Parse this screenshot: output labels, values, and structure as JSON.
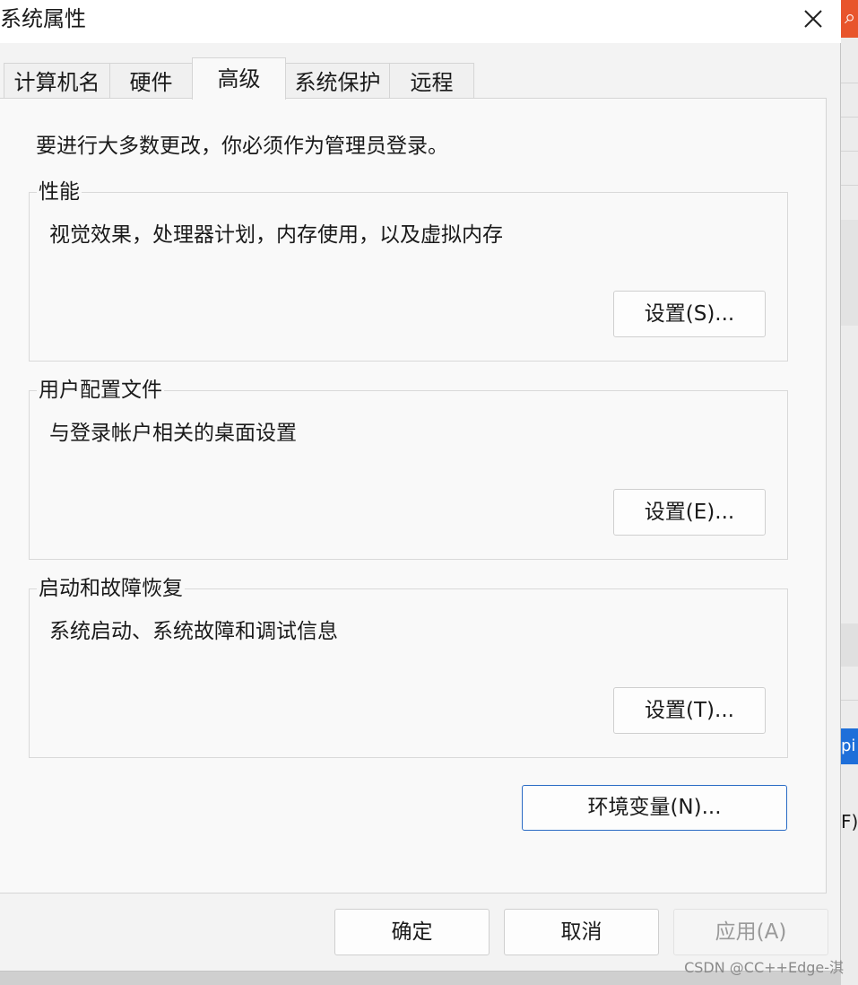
{
  "window": {
    "title": "系统属性"
  },
  "tabs": [
    {
      "label": "计算机名",
      "active": false
    },
    {
      "label": "硬件",
      "active": false
    },
    {
      "label": "高级",
      "active": true
    },
    {
      "label": "系统保护",
      "active": false
    },
    {
      "label": "远程",
      "active": false
    }
  ],
  "notice": "要进行大多数更改，你必须作为管理员登录。",
  "groups": [
    {
      "title": "性能",
      "description": "视觉效果，处理器计划，内存使用，以及虚拟内存",
      "button": "设置(S)..."
    },
    {
      "title": "用户配置文件",
      "description": "与登录帐户相关的桌面设置",
      "button": "设置(E)..."
    },
    {
      "title": "启动和故障恢复",
      "description": "系统启动、系统故障和调试信息",
      "button": "设置(T)..."
    }
  ],
  "env_button": "环境变量(N)...",
  "footer": {
    "ok": "确定",
    "cancel": "取消",
    "apply": "应用(A)"
  },
  "background": {
    "blue_fragment": "pi",
    "text_fragment": "F)"
  },
  "watermark": "CSDN @CC++Edge-淇",
  "colors": {
    "accent_border": "#2a6bc4",
    "bg_app_orange": "#e8552c"
  }
}
